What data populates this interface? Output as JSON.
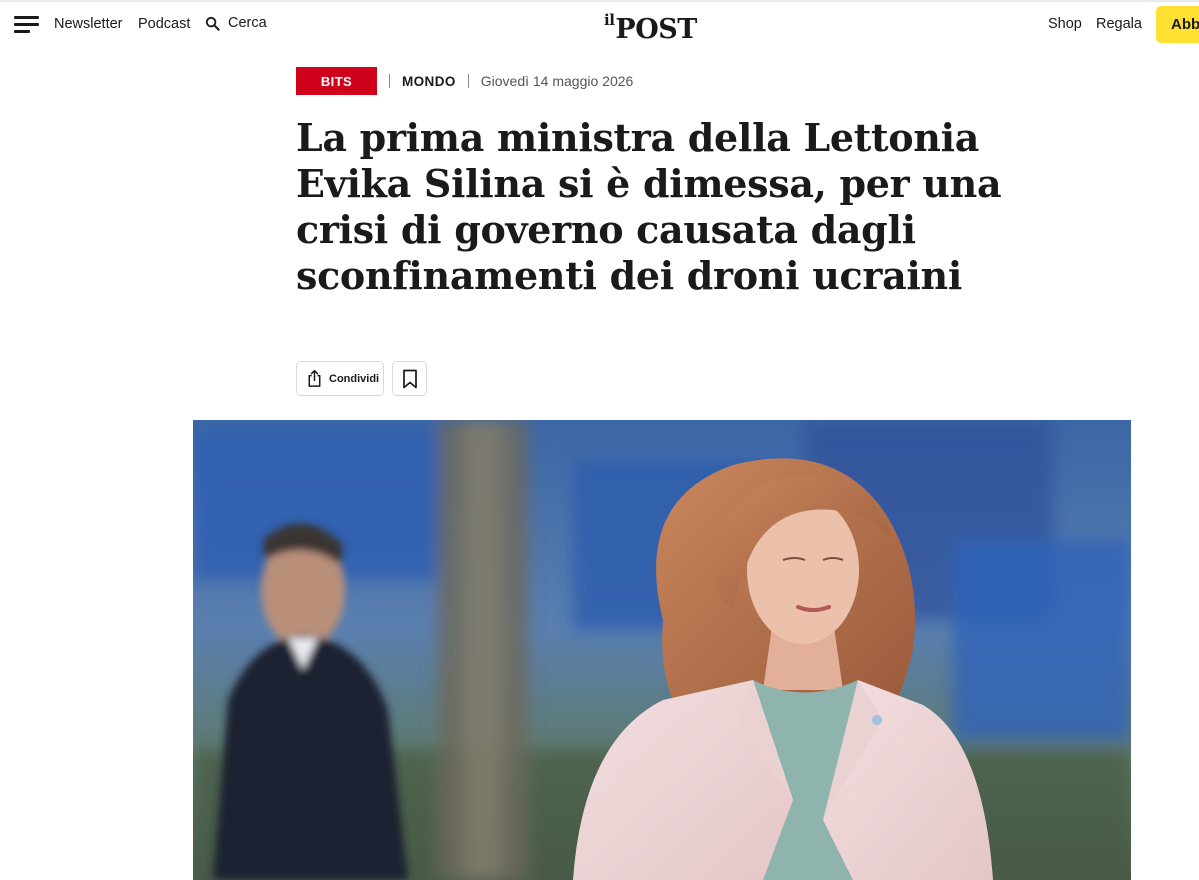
{
  "header": {
    "nav_left": {
      "newsletter": "Newsletter",
      "podcast": "Podcast",
      "search": "Cerca"
    },
    "logo": {
      "small": "il",
      "main": "POST"
    },
    "nav_right": {
      "shop": "Shop",
      "regala": "Regala",
      "subscribe": "Abb"
    },
    "subscribe_color": "#ffe033"
  },
  "article": {
    "badge": "BITS",
    "badge_color": "#d0021b",
    "category": "MONDO",
    "date": "Giovedì 14 maggio 2026",
    "headline": "La prima ministra della Lettonia Evika Silina si è dimessa, per una crisi di governo causata dagli sconfinamenti dei droni ucraini",
    "actions": {
      "share": "Condividi"
    }
  },
  "icons": [
    "hamburger-menu-icon",
    "search-icon",
    "share-icon",
    "bookmark-icon"
  ]
}
